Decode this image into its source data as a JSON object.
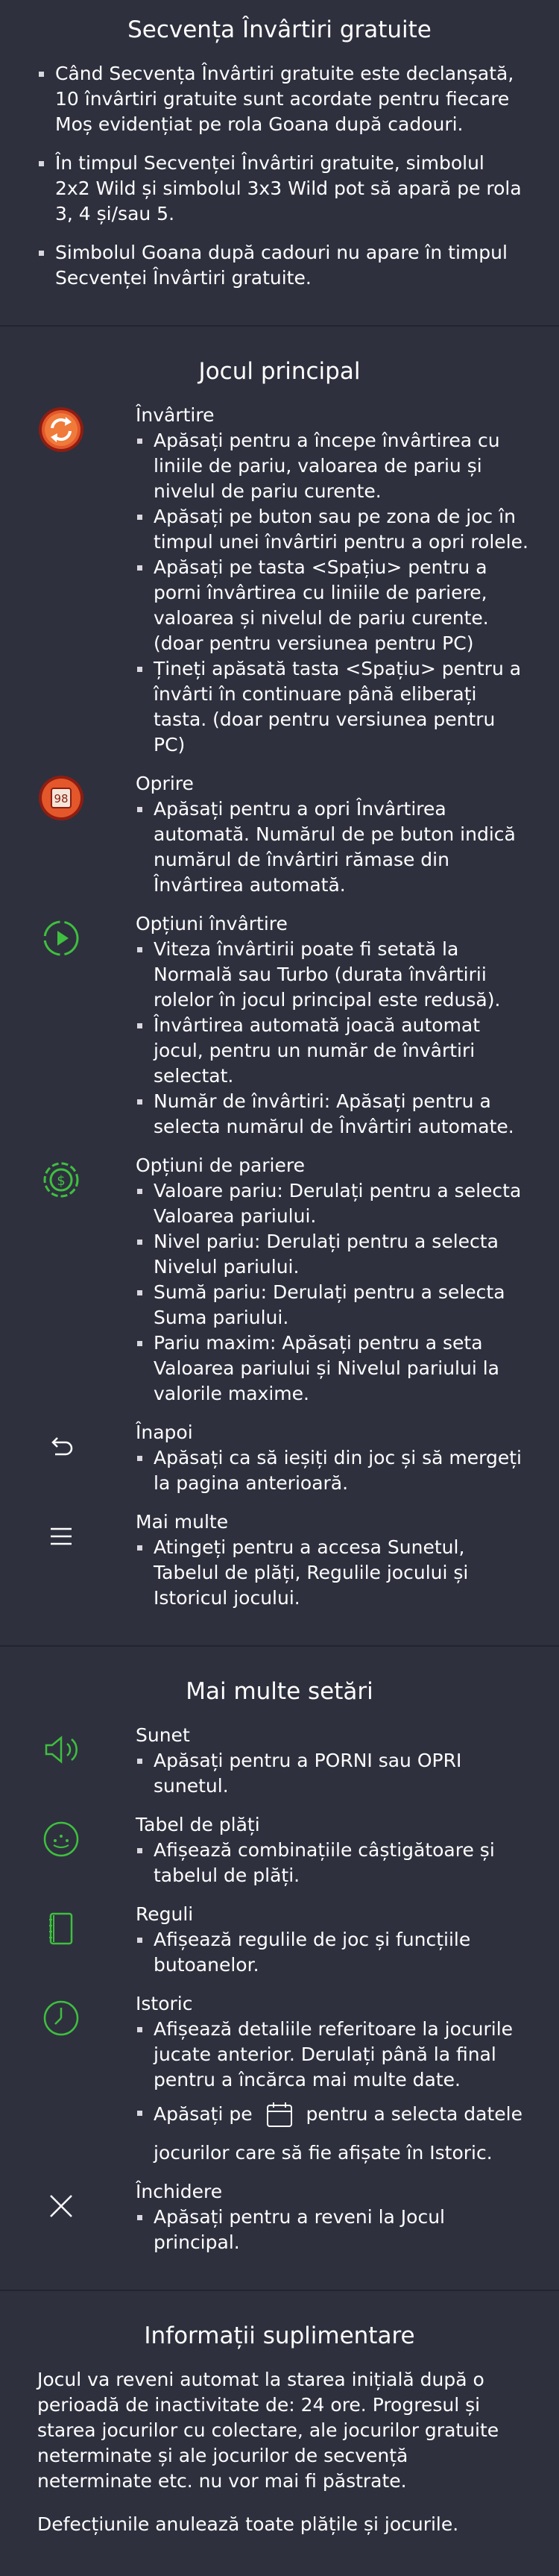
{
  "accent": "#3fbf3f",
  "sequence": {
    "title": "Secvența Învârtiri gratuite",
    "bullets": [
      "Când Secvența Învârtiri gratuite este declanșată, 10 învârtiri gratuite sunt acordate pentru fiecare Moș evidențiat pe rola Goana după cadouri.",
      "În timpul Secvenței Învârtiri gratuite, simbolul 2x2 Wild și simbolul 3x3 Wild pot să apară pe rola 3, 4 și/sau 5.",
      "Simbolul Goana după cadouri nu apare în timpul Secvenței Învârtiri gratuite."
    ]
  },
  "main_game": {
    "title": "Jocul principal",
    "items": [
      {
        "icon": "spin-button-icon",
        "name": "Învârtire",
        "bullets": [
          "Apăsați pentru a începe învârtirea cu liniile de pariu, valoarea de pariu și nivelul de pariu curente.",
          "Apăsați pe buton sau pe zona de joc în timpul unei învârtiri pentru a opri rolele.",
          "Apăsați pe tasta <Spațiu> pentru a porni învârtirea cu liniile de pariere, valoarea și nivelul de pariu curente. (doar pentru versiunea pentru PC)",
          "Țineți apăsată tasta <Spațiu> pentru a învârti în continuare până eliberați tasta. (doar pentru versiunea pentru PC)"
        ]
      },
      {
        "icon": "stop-button-icon",
        "icon_text": "98",
        "name": "Oprire",
        "bullets": [
          "Apăsați pentru a opri Învârtirea automată. Numărul de pe buton indică numărul de învârtiri rămase din Învârtirea automată."
        ]
      },
      {
        "icon": "spin-options-icon",
        "name": "Opțiuni învârtire",
        "bullets": [
          "Viteza învârtirii poate fi setată la Normală sau Turbo (durata învârtirii rolelor în jocul principal este redusă).",
          "Învârtirea automată joacă automat jocul, pentru un număr de învârtiri selectat.",
          "Număr de învârtiri: Apăsați pentru a selecta numărul de Învârtiri automate."
        ]
      },
      {
        "icon": "bet-options-icon",
        "name": "Opțiuni de pariere",
        "bullets": [
          "Valoare pariu: Derulați pentru a selecta Valoarea pariului.",
          "Nivel pariu: Derulați pentru a selecta Nivelul pariului.",
          "Sumă pariu: Derulați pentru a selecta Suma pariului.",
          "Pariu maxim: Apăsați pentru a seta Valoarea pariului și Nivelul pariului la valorile maxime."
        ]
      },
      {
        "icon": "back-icon",
        "name": "Înapoi",
        "bullets": [
          "Apăsați ca să ieșiți din joc și să mergeți la pagina anterioară."
        ]
      },
      {
        "icon": "menu-icon",
        "name": "Mai multe",
        "bullets": [
          "Atingeți pentru a accesa Sunetul, Tabelul de plăți, Regulile jocului și Istoricul jocului."
        ]
      }
    ]
  },
  "more_settings": {
    "title": "Mai multe setări",
    "items": [
      {
        "icon": "sound-icon",
        "name": "Sunet",
        "bullets": [
          "Apăsați pentru a PORNI sau OPRI sunetul."
        ]
      },
      {
        "icon": "paytable-icon",
        "name": "Tabel de plăți",
        "bullets": [
          "Afișează combinațiile câștigătoare și tabelul de plăți."
        ]
      },
      {
        "icon": "rules-icon",
        "name": "Reguli",
        "bullets": [
          "Afișează regulile de joc și funcțiile butoanelor."
        ]
      },
      {
        "icon": "history-icon",
        "name": "Istoric",
        "bullets": [
          "Afișează detaliile referitoare la jocurile jucate anterior. Derulați până la final pentru a încărca mai multe date."
        ],
        "calendar_before": "Apăsați pe",
        "calendar_after": "pentru a selecta datele",
        "calendar_line2": "jocurilor care să fie afișate în Istoric."
      },
      {
        "icon": "close-icon",
        "name": "Închidere",
        "bullets": [
          "Apăsați pentru a reveni la Jocul principal."
        ]
      }
    ]
  },
  "extra": {
    "title": "Informații suplimentare",
    "paragraphs": [
      "Jocul va reveni automat la starea inițială după o perioadă de inactivitate de: 24 ore. Progresul și starea jocurilor cu colectare, ale jocurilor gratuite neterminate și ale jocurilor de secvență neterminate etc. nu vor mai fi păstrate.",
      "Defecțiunile anulează toate plățile și jocurile."
    ]
  }
}
